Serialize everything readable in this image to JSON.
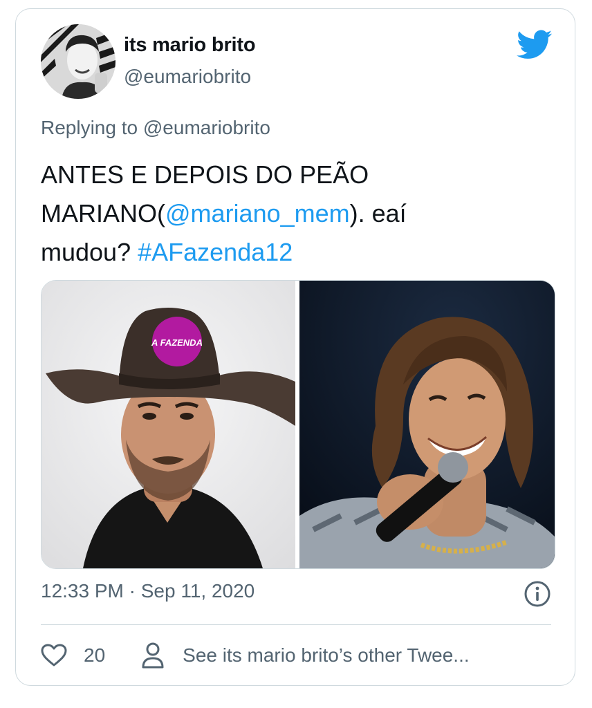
{
  "tweet": {
    "author": {
      "display_name": "its mario brito",
      "handle": "@eumariobrito"
    },
    "brand_icon": "twitter-bird-icon",
    "reply_prefix": "Replying to",
    "reply_mention": "@eumariobrito",
    "text": {
      "line1": "ANTES E DEPOIS DO PEÃO",
      "line2_prefix": "MARIANO(",
      "mention": "@mariano_mem",
      "line2_suffix": "). eaí",
      "line3_prefix": "mudou? ",
      "hashtag": "#AFazenda12"
    },
    "media": {
      "hat_badge": "A FAZENDA"
    },
    "timestamp": "12:33 PM · Sep 11, 2020",
    "likes": "20",
    "other_tweets_label": "See its mario brito’s other Twee..."
  },
  "colors": {
    "link": "#1d9bf0",
    "secondary_text": "#536471",
    "border": "#cfd9de",
    "twitter_blue": "#1d9bf0"
  }
}
